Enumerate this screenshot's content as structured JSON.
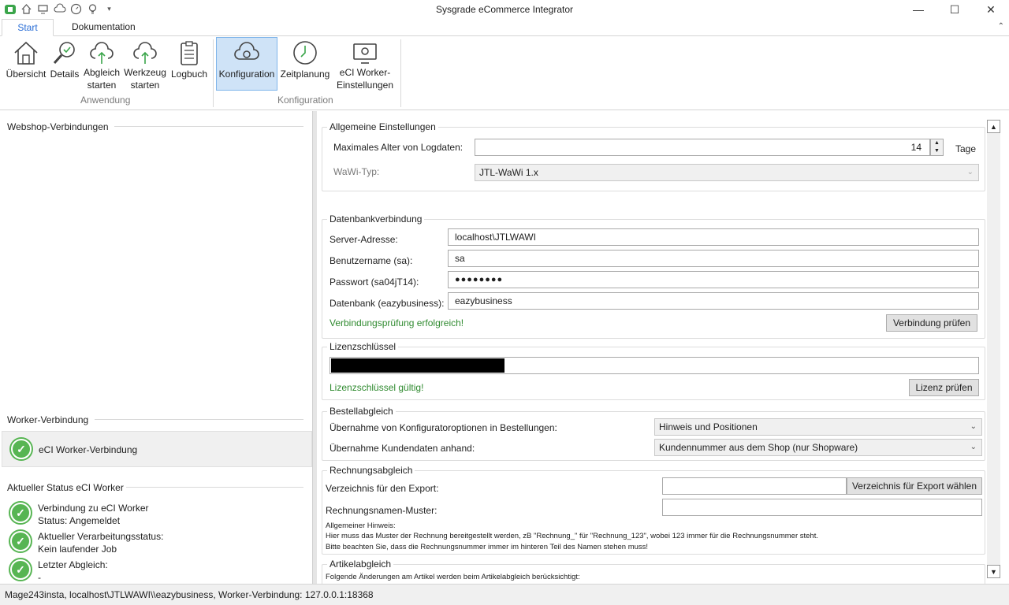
{
  "window": {
    "title": "Sysgrade eCommerce Integrator",
    "minimize": "—",
    "maximize": "☐",
    "close": "✕"
  },
  "tabs": [
    {
      "label": "Start"
    },
    {
      "label": "Dokumentation"
    }
  ],
  "ribbon": {
    "buttons": [
      {
        "label": "Übersicht",
        "icon": "house-icon"
      },
      {
        "label": "Details",
        "icon": "magnifier-check-icon"
      },
      {
        "label": "Abgleich\nstarten",
        "icon": "cloud-sync-icon"
      },
      {
        "label": "Werkzeug\nstarten",
        "icon": "cloud-tool-icon"
      },
      {
        "label": "Logbuch",
        "icon": "clipboard-icon"
      },
      {
        "label": "Konfiguration",
        "icon": "cloud-gear-icon"
      },
      {
        "label": "Zeitplanung",
        "icon": "clock-icon"
      },
      {
        "label": "eCI Worker-\nEinstellungen",
        "icon": "monitor-gear-icon"
      }
    ],
    "groups": [
      {
        "label": "Anwendung"
      },
      {
        "label": "Konfiguration"
      }
    ]
  },
  "left": {
    "webshop_header": "Webshop-Verbindungen",
    "worker_header": "Worker-Verbindung",
    "worker_item": "eCI Worker-Verbindung",
    "status_header": "Aktueller Status eCI Worker",
    "status_items": [
      {
        "line1": "Verbindung zu eCI Worker",
        "line2": "Status: Angemeldet"
      },
      {
        "line1": "Aktueller Verarbeitungsstatus:",
        "line2": "Kein laufender Job"
      },
      {
        "line1": "Letzter Abgleich:",
        "line2": "-"
      }
    ]
  },
  "general": {
    "legend": "Allgemeine Einstellungen",
    "max_age_label": "Maximales Alter von Logdaten:",
    "max_age_value": "14",
    "max_age_unit": "Tage",
    "wawi_label": "WaWi-Typ:",
    "wawi_value": "JTL-WaWi 1.x"
  },
  "db": {
    "legend": "Datenbankverbindung",
    "server_label": "Server-Adresse:",
    "server_value": "localhost\\JTLWAWI",
    "user_label": "Benutzername (sa):",
    "user_value": "sa",
    "pass_label": "Passwort (sa04jT14):",
    "pass_value": "●●●●●●●●",
    "dbname_label": "Datenbank (eazybusiness):",
    "dbname_value": "eazybusiness",
    "status": "Verbindungsprüfung erfolgreich!",
    "check_button": "Verbindung prüfen"
  },
  "license": {
    "legend": "Lizenzschlüssel",
    "status": "Lizenzschlüssel gültig!",
    "check_button": "Lizenz prüfen"
  },
  "orders": {
    "legend": "Bestellabgleich",
    "config_label": "Übernahme von Konfiguratoroptionen in Bestellungen:",
    "config_value": "Hinweis und Positionen",
    "customer_label": "Übernahme Kundendaten anhand:",
    "customer_value": "Kundennummer aus dem Shop (nur Shopware)"
  },
  "invoice": {
    "legend": "Rechnungsabgleich",
    "export_label": "Verzeichnis für den Export:",
    "export_button": "Verzeichnis für Export wählen",
    "pattern_label": "Rechnungsnamen-Muster:",
    "hint_title": "Allgemeiner Hinweis:",
    "hint_line1": "Hier muss das Muster der Rechnung bereitgestellt werden, zB \"Rechnung_\" für \"Rechnung_123\", wobei 123 immer für die Rechnungsnummer steht.",
    "hint_line2": "Bitte beachten Sie, dass die Rechnungsnummer immer im hinteren Teil des Namen stehen muss!"
  },
  "articles": {
    "legend": "Artikelabgleich",
    "text": "Folgende Änderungen am Artikel werden beim Artikelabgleich berücksichtigt:"
  },
  "statusbar": {
    "text": "Mage243insta, localhost\\JTLWAWI\\\\eazybusiness, Worker-Verbindung: 127.0.0.1:18368"
  },
  "colors": {
    "accent": "#2a6ed6",
    "success": "#2f8a2f",
    "check": "#57b553",
    "selected": "#cfe3f7"
  }
}
